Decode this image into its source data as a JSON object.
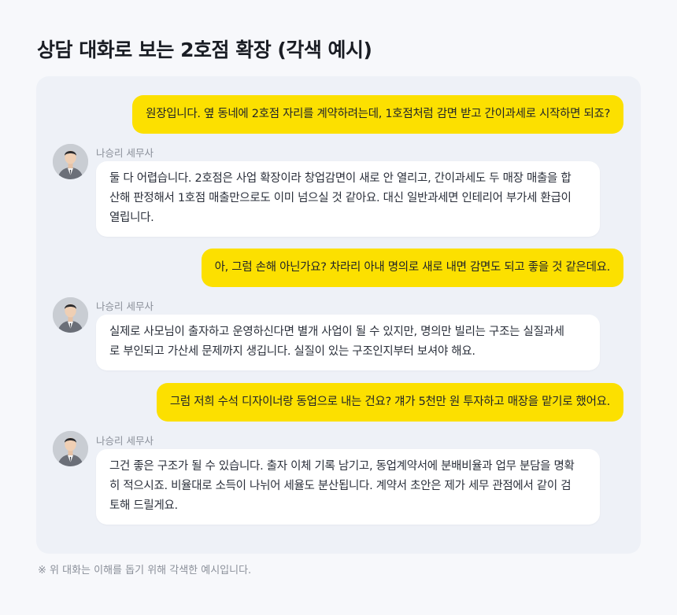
{
  "page": {
    "title": "상담 대화로 보는 2호점 확장 (각색 예시)",
    "footnote": "※ 위 대화는 이해를 돕기 위해 각색한 예시입니다."
  },
  "advisor": {
    "name": "나승리 세무사",
    "avatar_icon": "advisor-portrait-icon"
  },
  "colors": {
    "user_bubble": "#fce000",
    "advisor_bubble": "#ffffff",
    "panel": "#eef1f7",
    "page_bg": "#f7f8fb"
  },
  "messages": [
    {
      "sender": "user",
      "lines": [
        "원장입니다. 옆 동네에 2호점 자리를 계약하려는데, 1호점처럼 감면 받고 간이과세로 시작하면 되죠?"
      ]
    },
    {
      "sender": "advisor",
      "lines": [
        "둘 다 어렵습니다. 2호점은 사업 확장이라 창업감면이 새로 안 열리고, 간이과세도 두 매장 매출을 합",
        "산해 판정해서 1호점 매출만으로도 이미 넘으실 것 같아요. 대신 일반과세면 인테리어 부가세 환급이",
        "열립니다."
      ]
    },
    {
      "sender": "user",
      "lines": [
        "아, 그럼 손해 아닌가요? 차라리 아내 명의로 새로 내면 감면도 되고 좋을 것 같은데요."
      ]
    },
    {
      "sender": "advisor",
      "lines": [
        "실제로 사모님이 출자하고 운영하신다면 별개 사업이 될 수 있지만, 명의만 빌리는 구조는 실질과세",
        "로 부인되고 가산세 문제까지 생깁니다. 실질이 있는 구조인지부터 보셔야 해요."
      ]
    },
    {
      "sender": "user",
      "lines": [
        "그럼 저희 수석 디자이너랑 동업으로 내는 건요? 걔가 5천만 원 투자하고 매장을 맡기로 했어요."
      ]
    },
    {
      "sender": "advisor",
      "lines": [
        "그건 좋은 구조가 될 수 있습니다. 출자 이체 기록 남기고, 동업계약서에 분배비율과 업무 분담을 명확",
        "히 적으시죠. 비율대로 소득이 나뉘어 세율도 분산됩니다. 계약서 초안은 제가 세무 관점에서 같이 검",
        "토해 드릴게요."
      ]
    }
  ]
}
